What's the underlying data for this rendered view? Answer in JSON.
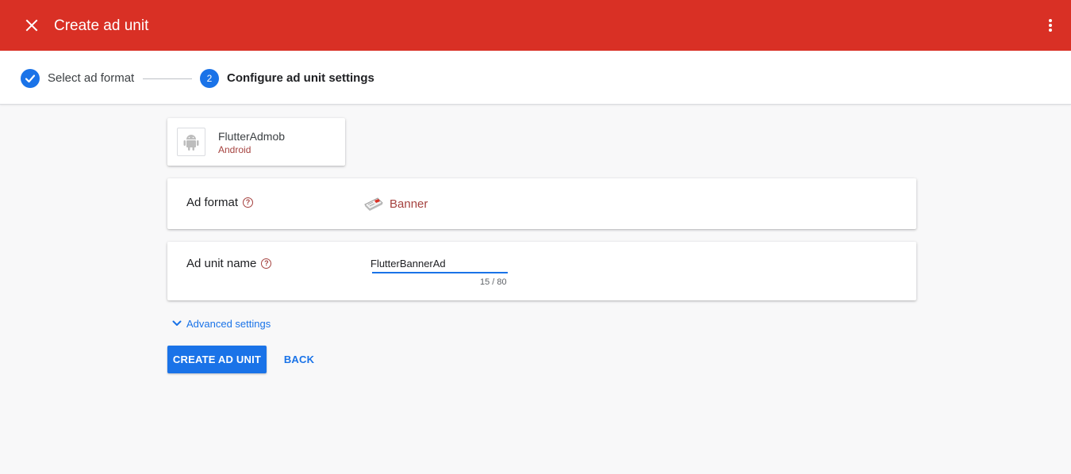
{
  "header": {
    "title": "Create ad unit",
    "close_icon": "close-icon",
    "more_icon": "more-vert-icon"
  },
  "stepper": {
    "steps": [
      {
        "label": "Select ad format",
        "state": "completed",
        "icon": "check-icon"
      },
      {
        "label": "Configure ad unit settings",
        "state": "active",
        "number": "2"
      }
    ]
  },
  "app": {
    "name": "FlutterAdmob",
    "platform": "Android",
    "icon": "android-icon"
  },
  "ad_format": {
    "label": "Ad format",
    "value": "Banner",
    "icon": "banner-icon",
    "help_icon": "help-icon"
  },
  "ad_unit_name": {
    "label": "Ad unit name",
    "value": "FlutterBannerAd",
    "char_count": "15 / 80",
    "help_icon": "help-icon"
  },
  "advanced_settings": {
    "label": "Advanced settings",
    "icon": "chevron-down-icon"
  },
  "actions": {
    "create_label": "CREATE AD UNIT",
    "back_label": "BACK"
  },
  "colors": {
    "header_bg": "#d93025",
    "accent": "#1a73e8",
    "secondary_text": "#a5423f"
  }
}
